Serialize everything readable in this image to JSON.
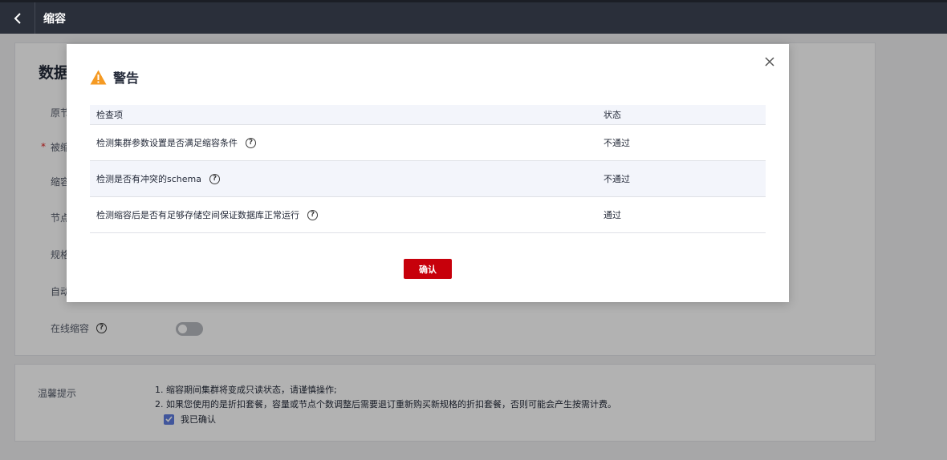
{
  "topbar": {
    "title": "缩容"
  },
  "form": {
    "section_title": "数据",
    "rows": [
      {
        "label": "原节"
      },
      {
        "label": "被缩"
      },
      {
        "label": "缩容"
      },
      {
        "label": "节点"
      },
      {
        "label": "规格"
      },
      {
        "label": "自动"
      }
    ],
    "required_mark": "*",
    "online_shrink_label": "在线缩容"
  },
  "tips": {
    "label": "温馨提示",
    "line1": "1. 缩容期间集群将变成只读状态，请谨慎操作;",
    "line2": "2. 如果您使用的是折扣套餐，容量或节点个数调整后需要退订重新购买新规格的折扣套餐，否则可能会产生按需计费。",
    "confirm_label": "我已确认"
  },
  "modal": {
    "title": "警告",
    "columns": [
      "检查项",
      "状态"
    ],
    "rows": [
      {
        "item": "检测集群参数设置是否满足缩容条件",
        "status": "不通过"
      },
      {
        "item": "检测是否有冲突的schema",
        "status": "不通过"
      },
      {
        "item": "检测缩容后是否有足够存储空间保证数据库正常运行",
        "status": "通过"
      }
    ],
    "ok_label": "确认"
  },
  "colors": {
    "accent": "#c7000b",
    "warning": "#f59a23",
    "checkbox": "#5e7ce0",
    "topbar": "#2a2f3a"
  }
}
